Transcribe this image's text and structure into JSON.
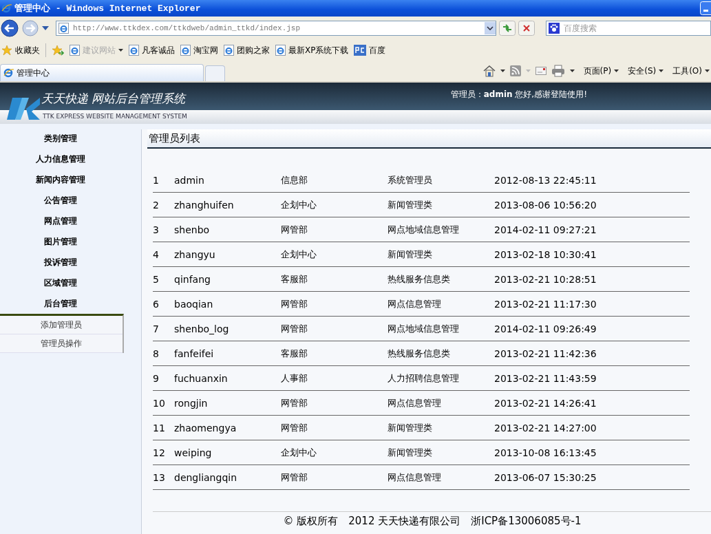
{
  "window": {
    "title": "管理中心 - Windows Internet Explorer"
  },
  "address_bar": {
    "url": "http://www.ttkdex.com/ttkdweb/admin_ttkd/index.jsp"
  },
  "search": {
    "placeholder": "百度搜索"
  },
  "favorites": {
    "label": "收藏夹",
    "links": [
      {
        "label": "建议网站",
        "disabled": true,
        "kind": "ie"
      },
      {
        "label": "凡客诚品",
        "disabled": false,
        "kind": "ie"
      },
      {
        "label": "淘宝网",
        "disabled": false,
        "kind": "ie"
      },
      {
        "label": "团购之家",
        "disabled": false,
        "kind": "ie"
      },
      {
        "label": "最新XP系统下载",
        "disabled": false,
        "kind": "ie"
      },
      {
        "label": "百度",
        "disabled": false,
        "kind": "pc"
      }
    ]
  },
  "tabs": [
    {
      "label": "管理中心",
      "selected": true
    }
  ],
  "command_bar": [
    "页面(P)",
    "安全(S)",
    "工具(O)"
  ],
  "header": {
    "title": "天天快递 网站后台管理系统",
    "subtitle": "TTK EXPRESS WEBSITE MANAGEMENT SYSTEM",
    "greeting": "管理员：**admin** 您好,感谢登陆使用!"
  },
  "sidebar": {
    "items": [
      {
        "label": "类别管理"
      },
      {
        "label": "人力信息管理"
      },
      {
        "label": "新闻内容管理"
      },
      {
        "label": "公告管理"
      },
      {
        "label": "网点管理"
      },
      {
        "label": "图片管理"
      },
      {
        "label": "投诉管理"
      },
      {
        "label": "区域管理"
      },
      {
        "label": "后台管理",
        "children": [
          {
            "label": "添加管理员"
          },
          {
            "label": "管理员操作"
          }
        ]
      }
    ]
  },
  "panel": {
    "title": "管理员列表"
  },
  "table": {
    "rows": [
      [
        "1",
        "admin",
        "信息部",
        "系统管理员",
        "2012-08-13 22:45:11"
      ],
      [
        "2",
        "zhanghuifen",
        "企划中心",
        "新闻管理类",
        "2013-08-06 10:56:20"
      ],
      [
        "3",
        "shenbo",
        "网管部",
        "网点地域信息管理",
        "2014-02-11 09:27:21"
      ],
      [
        "4",
        "zhangyu",
        "企划中心",
        "新闻管理类",
        "2013-02-18 10:30:41"
      ],
      [
        "5",
        "qinfang",
        "客服部",
        "热线服务信息类",
        "2013-02-21 10:28:51"
      ],
      [
        "6",
        "baoqian",
        "网管部",
        "网点信息管理",
        "2013-02-21 11:17:30"
      ],
      [
        "7",
        "shenbo_log",
        "网管部",
        "网点地域信息管理",
        "2014-02-11 09:26:49"
      ],
      [
        "8",
        "fanfeifei",
        "客服部",
        "热线服务信息类",
        "2013-02-21 11:42:36"
      ],
      [
        "9",
        "fuchuanxin",
        "人事部",
        "人力招聘信息管理",
        "2013-02-21 11:43:59"
      ],
      [
        "10",
        "rongjin",
        "网管部",
        "网点信息管理",
        "2013-02-21 14:26:41"
      ],
      [
        "11",
        "zhaomengya",
        "网管部",
        "新闻管理类",
        "2013-02-21 14:27:00"
      ],
      [
        "12",
        "weiping",
        "企划中心",
        "新闻管理类",
        "2013-10-08 16:13:45"
      ],
      [
        "13",
        "dengliangqin",
        "网管部",
        "网点信息管理",
        "2013-06-07 15:30:25"
      ]
    ]
  },
  "footer": {
    "text": "© 版权所有　2012 天天快递有限公司　浙ICP备13006085号-1"
  }
}
